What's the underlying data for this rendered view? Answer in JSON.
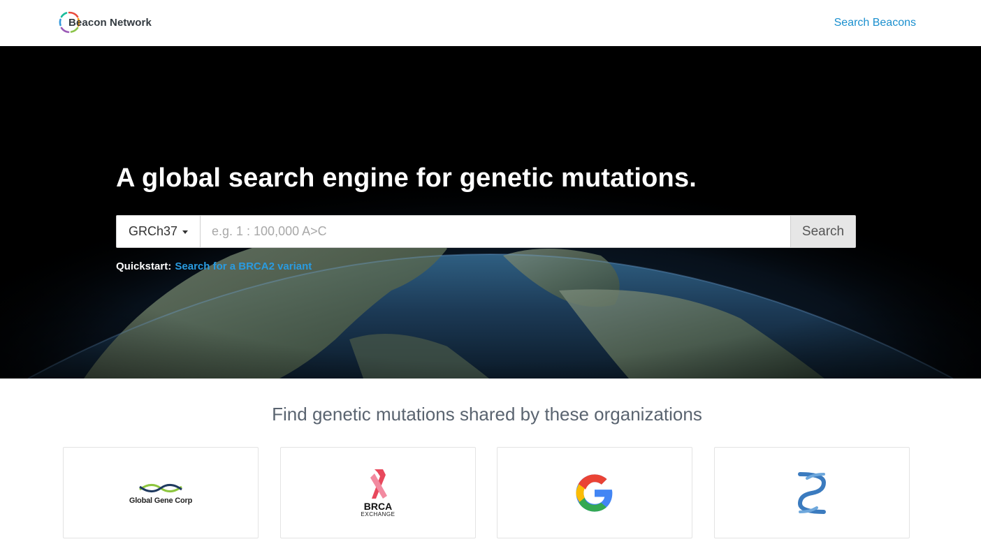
{
  "navbar": {
    "brand_name": "Beacon Network",
    "nav_link": "Search Beacons"
  },
  "hero": {
    "title": "A global search engine for genetic mutations.",
    "assembly_selected": "GRCh37",
    "search_placeholder": "e.g. 1 : 100,000 A>C",
    "search_button": "Search",
    "quickstart_label": "Quickstart:",
    "quickstart_link": "Search for a BRCA2 variant"
  },
  "organizations": {
    "title": "Find genetic mutations shared by these organizations",
    "items": [
      {
        "name": "Global Gene Corp",
        "icon": "global-gene-corp-logo"
      },
      {
        "name": "BRCA",
        "subtitle": "EXCHANGE",
        "icon": "brca-exchange-logo"
      },
      {
        "icon": "google-logo"
      },
      {
        "icon": "helix-logo"
      }
    ]
  },
  "colors": {
    "link": "#1a8fce",
    "quickstart_link": "#2a9be0",
    "hero_bg": "#000000",
    "section_title": "#5a6470"
  }
}
